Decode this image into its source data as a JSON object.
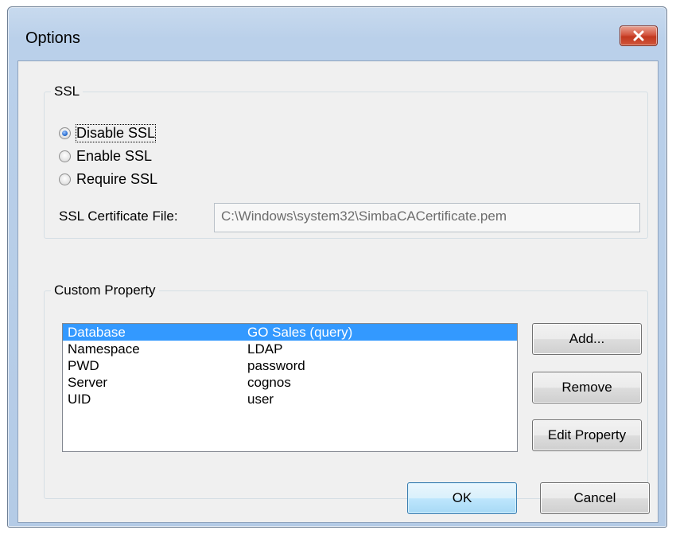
{
  "window": {
    "title": "Options"
  },
  "ssl_group": {
    "label": "SSL",
    "options": [
      {
        "label": "Disable SSL",
        "checked": true
      },
      {
        "label": "Enable SSL",
        "checked": false
      },
      {
        "label": "Require SSL",
        "checked": false
      }
    ],
    "cert_label": "SSL Certificate File:",
    "cert_value": "C:\\Windows\\system32\\SimbaCACertificate.pem"
  },
  "custom_group": {
    "label": "Custom Property",
    "rows": [
      {
        "key": "Database",
        "value": "GO Sales (query)",
        "selected": true
      },
      {
        "key": "Namespace",
        "value": "LDAP",
        "selected": false
      },
      {
        "key": "PWD",
        "value": "password",
        "selected": false
      },
      {
        "key": "Server",
        "value": "cognos",
        "selected": false
      },
      {
        "key": "UID",
        "value": "user",
        "selected": false
      }
    ],
    "buttons": {
      "add": "Add...",
      "remove": "Remove",
      "edit": "Edit Property"
    }
  },
  "footer": {
    "ok": "OK",
    "cancel": "Cancel"
  },
  "icons": {
    "close": "close-icon"
  },
  "colors": {
    "selection": "#3399ff",
    "close_button": "#c2381f"
  }
}
